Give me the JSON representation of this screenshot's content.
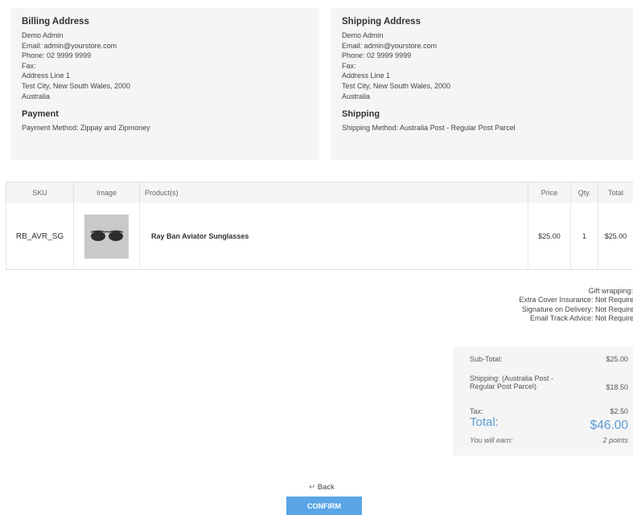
{
  "billing": {
    "title": "Billing Address",
    "lines": [
      "Demo Admin",
      "Email: admin@yourstore.com",
      "Phone: 02 9999 9999",
      "Fax:",
      "Address Line 1",
      "Test City, New South Wales, 2000",
      "Australia"
    ],
    "payment_title": "Payment",
    "payment_method": "Payment Method: Zippay and Zipmoney"
  },
  "shipping": {
    "title": "Shipping Address",
    "lines": [
      "Demo Admin",
      "Email: admin@yourstore.com",
      "Phone: 02 9999 9999",
      "Fax:",
      "Address Line 1",
      "Test City, New South Wales, 2000",
      "Australia"
    ],
    "shipping_title": "Shipping",
    "shipping_method": "Shipping Method: Australia Post - Regular Post Parcel"
  },
  "table": {
    "headers": [
      "SKU",
      "Image",
      "Product(s)",
      "Price",
      "Qty.",
      "Total"
    ],
    "rows": [
      {
        "sku": "RB_AVR_SG",
        "product": "Ray Ban Aviator Sunglasses",
        "price": "$25.00",
        "qty": "1",
        "total": "$25.00",
        "image_icon": "sunglasses-icon"
      }
    ]
  },
  "options": [
    "Gift wrapping: No",
    "Extra Cover Insurance: Not Required",
    "Signature on Delivery: Not Required",
    "Email Track Advice: Not Required"
  ],
  "totals": {
    "subtotal_label": "Sub-Total:",
    "subtotal_value": "$25.00",
    "shipping_label": "Shipping: (Australia Post - Regular Post Parcel)",
    "shipping_value": "$18.50",
    "tax_label": "Tax:",
    "tax_value": "$2.50",
    "total_label": "Total:",
    "total_value": "$46.00",
    "earn_label": "You will earn:",
    "earn_value": "2 points"
  },
  "actions": {
    "back_label": "Back",
    "back_icon": "return-arrow-icon",
    "confirm_label": "CONFIRM"
  },
  "colors": {
    "accent": "#5aa5e6",
    "total_text": "#5b9bd5",
    "panel_bg": "#f5f5f5"
  }
}
